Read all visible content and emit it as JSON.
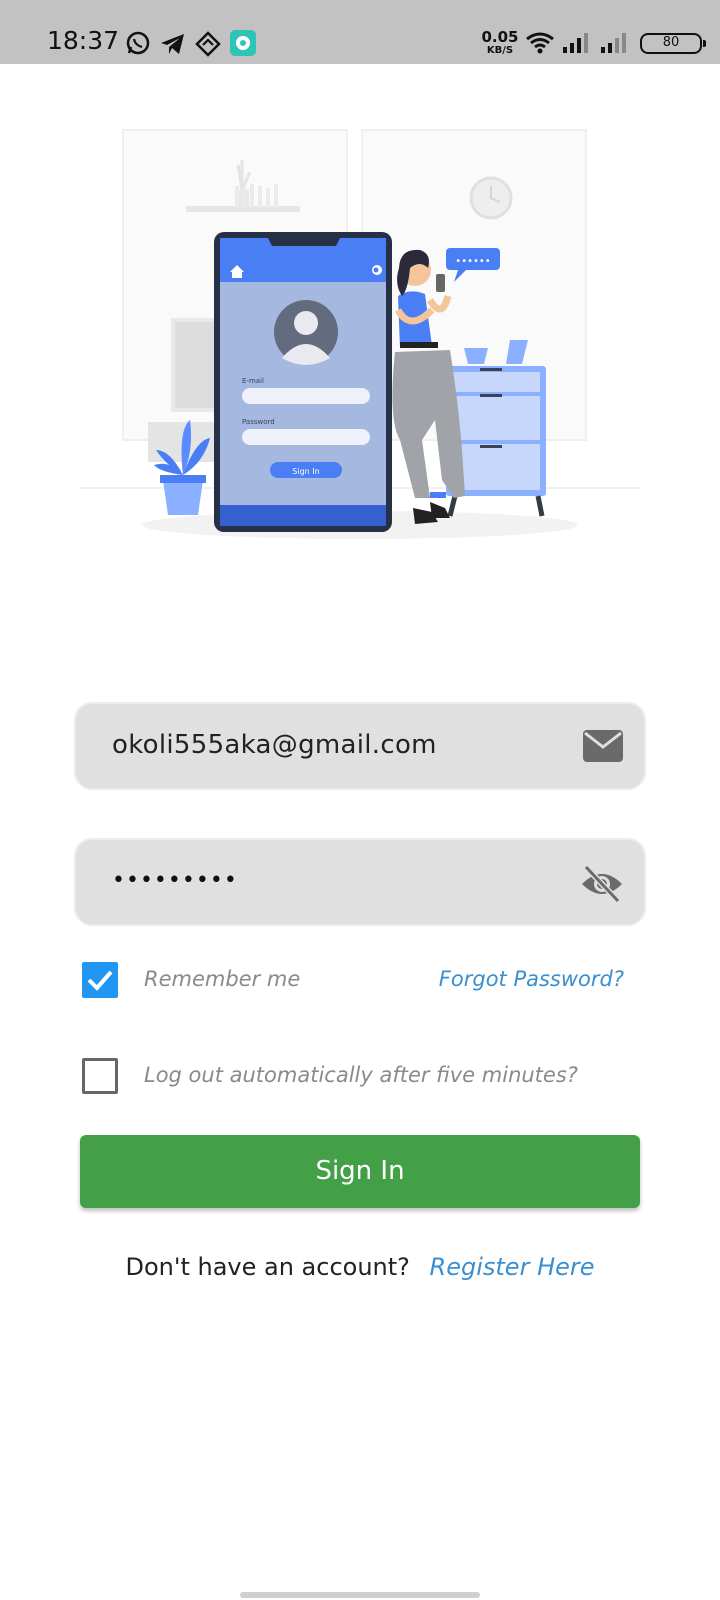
{
  "status_bar": {
    "time": "18:37",
    "net_speed_value": "0.05",
    "net_speed_unit": "KB/S",
    "battery": "80",
    "icons": [
      "whatsapp-icon",
      "telegram-icon",
      "location-app-icon",
      "teal-app-icon",
      "wifi-icon",
      "signal-icon",
      "signal-icon-2",
      "battery-icon"
    ]
  },
  "illustration": {
    "phone_email_label": "E-mail",
    "phone_password_label": "Password",
    "phone_button_label": "Sign In",
    "speech_bubble": "••••••"
  },
  "form": {
    "email_value": "okoli555aka@gmail.com",
    "password_masked": "•••••••••",
    "remember_me_label": "Remember me",
    "remember_me_checked": true,
    "forgot_password_label": "Forgot Password?",
    "auto_logout_label": "Log out automatically after five minutes?",
    "auto_logout_checked": false,
    "sign_in_label": "Sign In"
  },
  "register": {
    "question": "Don't have an account?",
    "link_label": "Register Here"
  },
  "colors": {
    "primary_blue": "#2196f3",
    "link_blue": "#3a8fd0",
    "button_green": "#43a047",
    "field_bg": "#e0e0e0",
    "illustration_blue": "#4a7ef5"
  }
}
